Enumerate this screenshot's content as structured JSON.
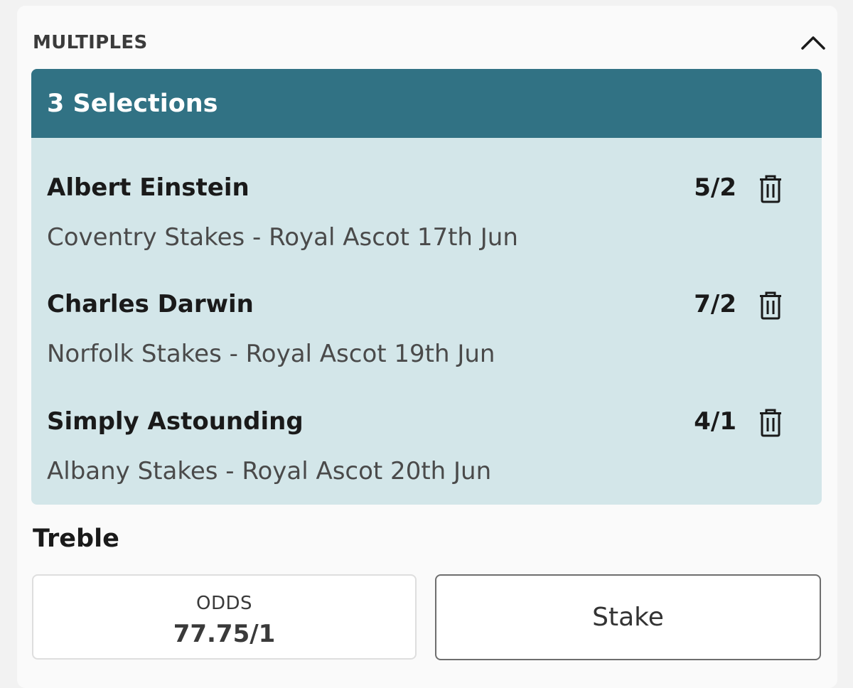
{
  "section": {
    "title": "MULTIPLES",
    "collapse_icon": "chevron-up-icon"
  },
  "selections": {
    "header": "3 Selections",
    "items": [
      {
        "name": "Albert Einstein",
        "odds": "5/2",
        "event": "Coventry Stakes - Royal Ascot 17th Jun"
      },
      {
        "name": "Charles Darwin",
        "odds": "7/2",
        "event": "Norfolk Stakes - Royal Ascot 19th Jun"
      },
      {
        "name": "Simply Astounding",
        "odds": "4/1",
        "event": "Albany Stakes - Royal Ascot 20th Jun"
      }
    ],
    "delete_icon": "trash-icon"
  },
  "bet": {
    "type": "Treble",
    "odds_label": "ODDS",
    "odds_value": "77.75/1",
    "stake_placeholder": "Stake"
  },
  "colors": {
    "header_bg": "#317284",
    "panel_bg": "#d3e6e9",
    "card_bg": "#fafafa"
  }
}
